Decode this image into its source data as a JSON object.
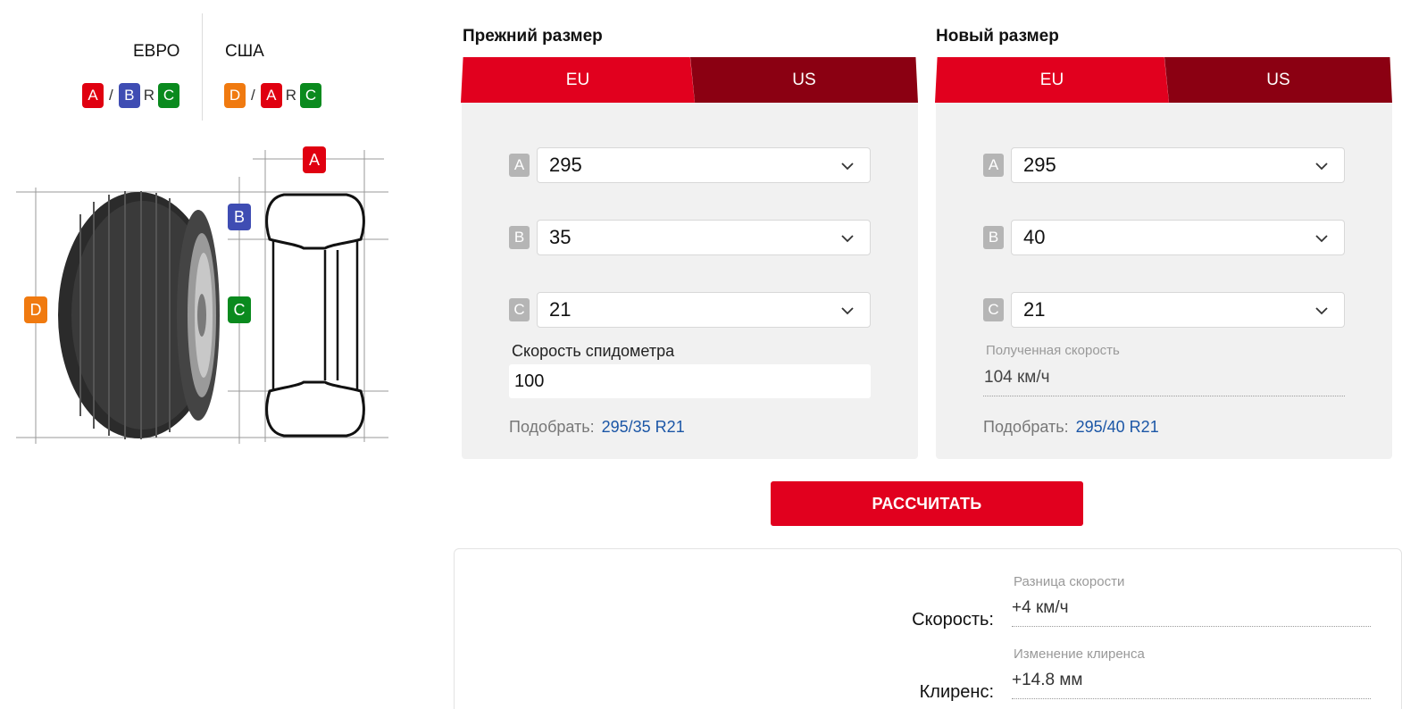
{
  "legend": {
    "eu_title": "ЕВРО",
    "us_title": "США",
    "eu_format": {
      "a": "A",
      "sep": "/",
      "b": "B",
      "r": "R",
      "c": "C"
    },
    "us_format": {
      "d": "D",
      "sep": "/",
      "a": "A",
      "r": "R",
      "c": "C"
    }
  },
  "diagram": {
    "a": "A",
    "b": "B",
    "c": "C",
    "d": "D"
  },
  "old_size": {
    "heading": "Прежний размер",
    "tabs": {
      "eu": "EU",
      "us": "US",
      "active": "EU"
    },
    "fields": {
      "a_label": "A",
      "a_value": "295",
      "b_label": "B",
      "b_value": "35",
      "c_label": "C",
      "c_value": "21"
    },
    "speed_label": "Скорость спидометра",
    "speed_value": "100",
    "pick_label": "Подобрать:",
    "pick_link": "295/35 R21"
  },
  "new_size": {
    "heading": "Новый размер",
    "tabs": {
      "eu": "EU",
      "us": "US",
      "active": "EU"
    },
    "fields": {
      "a_label": "A",
      "a_value": "295",
      "b_label": "B",
      "b_value": "40",
      "c_label": "C",
      "c_value": "21"
    },
    "result_speed_label": "Полученная скорость",
    "result_speed_value": "104 км/ч",
    "pick_label": "Подобрать:",
    "pick_link": "295/40 R21"
  },
  "calculate_button": "РАССЧИТАТЬ",
  "results": {
    "speed": {
      "caption": "Разница скорости",
      "name": "Скорость:",
      "value": "+4 км/ч"
    },
    "clearance": {
      "caption": "Изменение клиренса",
      "name": "Клиренс:",
      "value": "+14.8 мм"
    }
  },
  "colors": {
    "red": "#e1001e",
    "dark_red": "#8b0012",
    "blue": "#3f4db3",
    "green": "#0a8a1e",
    "orange": "#f07a10",
    "link": "#1b56a6"
  },
  "icons": {
    "select_arrow": "chevron-down-icon"
  }
}
